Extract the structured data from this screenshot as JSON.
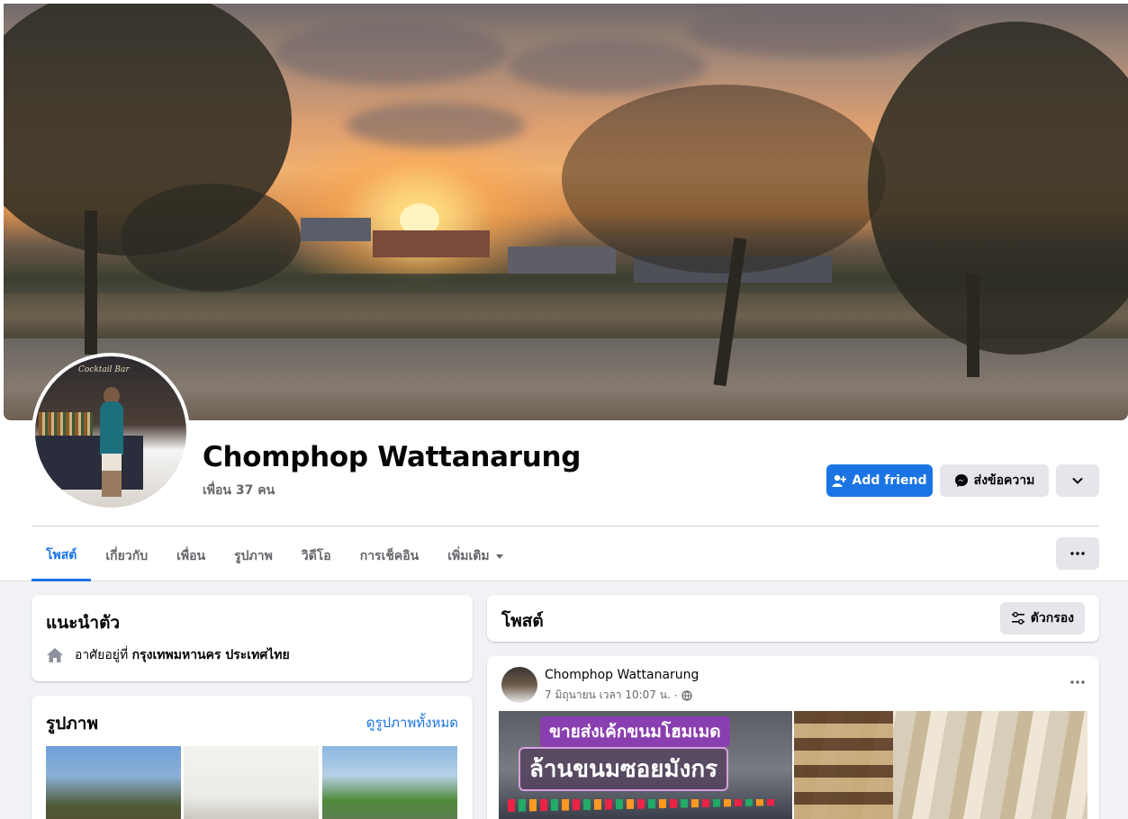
{
  "profile": {
    "name": "Chomphop Wattanarung",
    "friends_count": "เพื่อน 37 คน",
    "avatar_sign": "Cocktail Bar"
  },
  "actions": {
    "add_friend": "Add friend",
    "message": "ส่งข้อความ"
  },
  "tabs": [
    {
      "label": "โพสต์",
      "active": true
    },
    {
      "label": "เกี่ยวกับ"
    },
    {
      "label": "เพื่อน"
    },
    {
      "label": "รูปภาพ"
    },
    {
      "label": "วิดีโอ"
    },
    {
      "label": "การเช็คอิน"
    },
    {
      "label": "เพิ่มเติม"
    }
  ],
  "intro": {
    "title": "แนะนำตัว",
    "lives_prefix": "อาศัยอยู่ที่",
    "lives_place": "กรุงเทพมหานคร ประเทศไทย"
  },
  "photos": {
    "title": "รูปภาพ",
    "see_all": "ดูรูปภาพทั้งหมด"
  },
  "posts": {
    "title": "โพสต์",
    "filter_label": "ตัวกรอง",
    "items": [
      {
        "author": "Chomphop Wattanarung",
        "timestamp": "7 มิถุนายน เวลา 10:07 น.",
        "separator": "·",
        "image_text_1": "ขายส่งเค้กขนมโฮมเมด",
        "image_text_2": "ล้านขนมซอยมังกร"
      }
    ]
  },
  "colors": {
    "accent": "#1b74e4",
    "background": "#f0f2f5",
    "secondary_button": "#e4e6eb",
    "muted_text": "#65676b"
  },
  "icons": [
    "add-friend-icon",
    "messenger-icon",
    "chevron-down-icon",
    "more-icon",
    "home-icon",
    "filter-icon",
    "globe-icon",
    "caret-down-icon"
  ]
}
